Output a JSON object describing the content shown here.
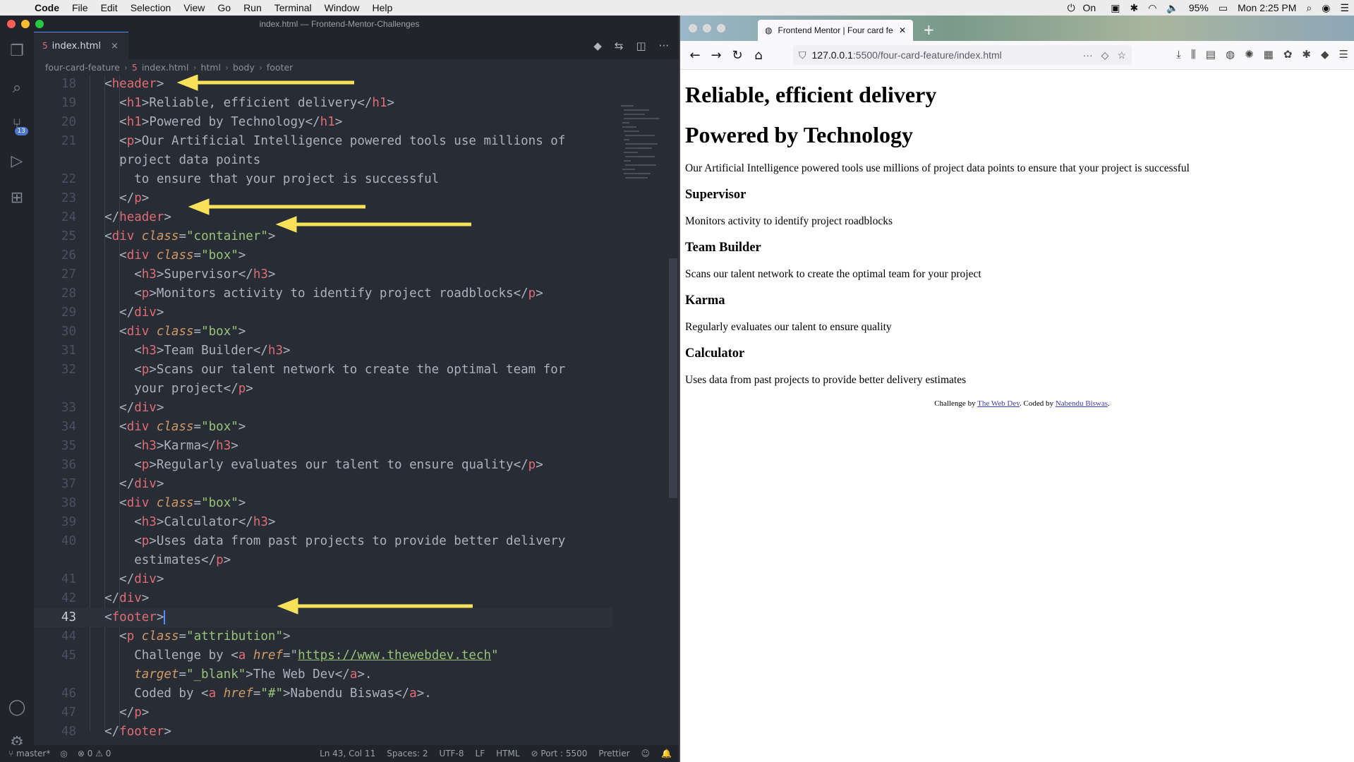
{
  "menubar": {
    "app": "Code",
    "items": [
      "File",
      "Edit",
      "Selection",
      "View",
      "Go",
      "Run",
      "Terminal",
      "Window",
      "Help"
    ],
    "status_on": "On",
    "battery": "95%",
    "clock": "Mon 2:25 PM"
  },
  "vscode": {
    "window_title": "index.html — Frontend-Mentor-Challenges",
    "tab_label": "index.html",
    "breadcrumb": [
      "four-card-feature",
      "index.html",
      "html",
      "body",
      "footer"
    ],
    "scm_badge": "13",
    "status": {
      "branch": "master*",
      "problems": "⊗ 0 ⚠ 0",
      "cursor": "Ln 43, Col 11",
      "spaces": "Spaces: 2",
      "encoding": "UTF-8",
      "eol": "LF",
      "language": "HTML",
      "port": "Port : 5500",
      "formatter": "Prettier"
    },
    "line_numbers": [
      "18",
      "19",
      "20",
      "21",
      "",
      "22",
      "23",
      "24",
      "25",
      "26",
      "27",
      "28",
      "29",
      "30",
      "31",
      "32",
      "",
      "33",
      "34",
      "35",
      "36",
      "37",
      "38",
      "39",
      "40",
      "",
      "41",
      "42",
      "43",
      "44",
      "45",
      "",
      "46",
      "47",
      "48"
    ]
  },
  "code": {
    "l18": [
      "<",
      "header",
      ">"
    ],
    "l19_h1": "Reliable, efficient delivery",
    "l20_h1": "Powered by Technology",
    "l21_p": "Our Artificial Intelligence powered tools use millions of",
    "l21_wrap": "project data points",
    "l22": "to ensure that your project is successful",
    "container_class": "\"container\"",
    "box_class": "\"box\"",
    "h3_supervisor": "Supervisor",
    "p_supervisor": "Monitors activity to identify project roadblocks",
    "h3_team": "Team Builder",
    "p_team": "Scans our talent network to create the optimal team for",
    "p_team_wrap": "your project",
    "h3_karma": "Karma",
    "p_karma": "Regularly evaluates our talent to ensure quality",
    "h3_calc": "Calculator",
    "p_calc": "Uses data from past projects to provide better delivery",
    "p_calc_wrap": "estimates",
    "attribution_class": "\"attribution\"",
    "challenge_by": "Challenge by ",
    "href_webdev": "https://www.thewebdev.tech",
    "target_blank": "\"_blank\"",
    "the_web_dev": "The Web Dev",
    "coded_by": "Coded by ",
    "href_hash": "\"#\"",
    "author": "Nabendu Biswas"
  },
  "browser": {
    "tab_title": "Frontend Mentor | Four card fe...",
    "url_host": "127.0.0.1",
    "url_path": ":5500/four-card-feature/index.html"
  },
  "page": {
    "h1_1": "Reliable, efficient delivery",
    "h1_2": "Powered by Technology",
    "intro": "Our Artificial Intelligence powered tools use millions of project data points to ensure that your project is successful",
    "cards": [
      {
        "title": "Supervisor",
        "text": "Monitors activity to identify project roadblocks"
      },
      {
        "title": "Team Builder",
        "text": "Scans our talent network to create the optimal team for your project"
      },
      {
        "title": "Karma",
        "text": "Regularly evaluates our talent to ensure quality"
      },
      {
        "title": "Calculator",
        "text": "Uses data from past projects to provide better delivery estimates"
      }
    ],
    "attr_challenge": "Challenge by ",
    "attr_webdev": "The Web Dev",
    "attr_coded": ". Coded by ",
    "attr_author": "Nabendu Biswas",
    "attr_end": "."
  },
  "colors": {
    "arrow": "#f7e15a",
    "editor_bg": "#282c34",
    "tag": "#e06c75",
    "string": "#98c379",
    "attribute": "#d19a66"
  }
}
